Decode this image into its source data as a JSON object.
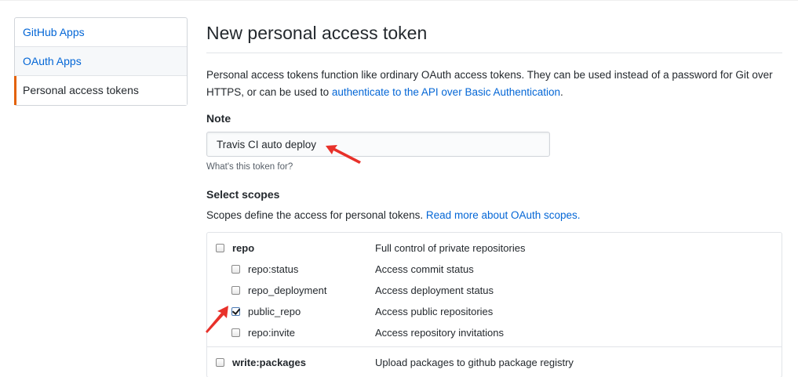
{
  "sidebar": {
    "items": [
      {
        "label": "GitHub Apps"
      },
      {
        "label": "OAuth Apps"
      },
      {
        "label": "Personal access tokens"
      }
    ]
  },
  "main": {
    "title": "New personal access token",
    "description_prefix": "Personal access tokens function like ordinary OAuth access tokens. They can be used instead of a password for Git over HTTPS, or can be used to ",
    "description_link": "authenticate to the API over Basic Authentication",
    "description_suffix": ".",
    "note_label": "Note",
    "note_value": "Travis CI auto deploy",
    "note_hint": "What's this token for?",
    "scopes_label": "Select scopes",
    "scopes_desc_prefix": "Scopes define the access for personal tokens. ",
    "scopes_desc_link": "Read more about OAuth scopes.",
    "scopes": [
      {
        "name": "repo",
        "desc": "Full control of private repositories",
        "checked": false
      },
      {
        "name": "repo:status",
        "desc": "Access commit status",
        "checked": false
      },
      {
        "name": "repo_deployment",
        "desc": "Access deployment status",
        "checked": false
      },
      {
        "name": "public_repo",
        "desc": "Access public repositories",
        "checked": true
      },
      {
        "name": "repo:invite",
        "desc": "Access repository invitations",
        "checked": false
      },
      {
        "name": "write:packages",
        "desc": "Upload packages to github package registry",
        "checked": false
      }
    ]
  },
  "colors": {
    "link": "#0366d6",
    "selected_accent": "#e36209",
    "annotation_arrow": "#e8312a"
  },
  "icons": {
    "annotation": "red-arrow-icon"
  }
}
